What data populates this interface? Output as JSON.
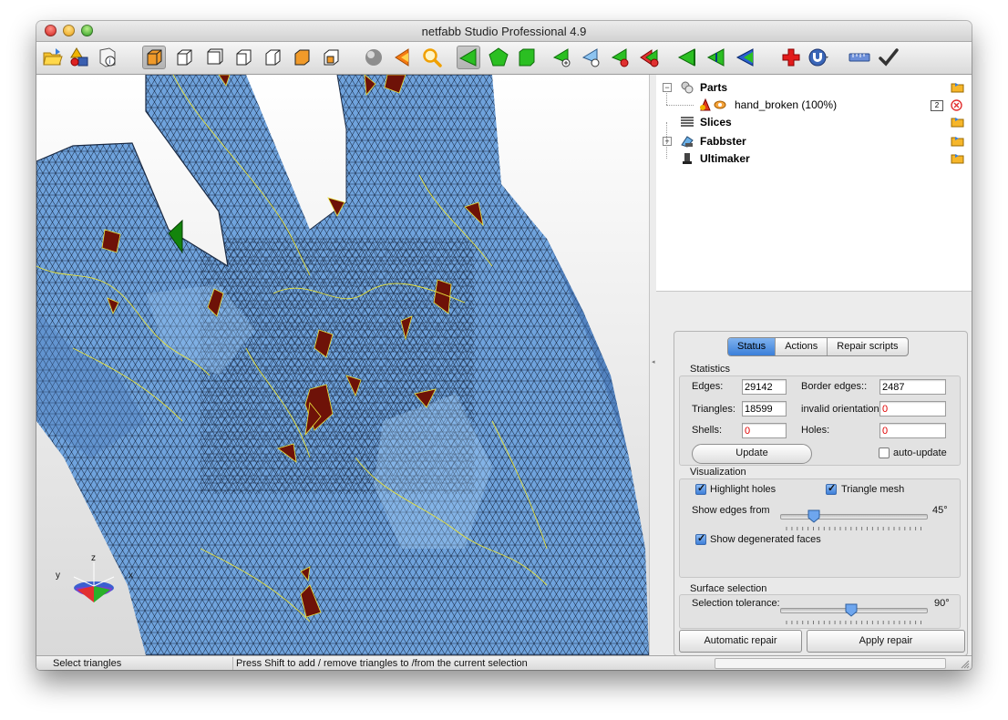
{
  "window": {
    "title": "netfabb Studio Professional 4.9"
  },
  "toolbar": {
    "buttons": [
      "open-folder-icon",
      "add-part-icon",
      "part-info-icon",
      "view-default-icon",
      "view-front-icon",
      "view-back-icon",
      "view-left-icon",
      "view-right-icon",
      "view-top-icon",
      "view-bottom-icon",
      "sphere-icon",
      "triangle-orange-icon",
      "zoom-icon",
      "select-triangle-icon",
      "select-surface-icon",
      "select-shell-icon",
      "add-triangle-icon",
      "delete-triangle-icon",
      "remove-triangle-icon",
      "remove-all-icon",
      "triangle-green-left-icon",
      "triangle-green-flip-icon",
      "triangle-blue-icon",
      "red-cross-icon",
      "magnet-icon",
      "ruler-icon",
      "checkmark-icon"
    ]
  },
  "tree": {
    "parts_label": "Parts",
    "part_item_label": "hand_broken (100%)",
    "part_item_badge": "2",
    "slices_label": "Slices",
    "fabbster_label": "Fabbster",
    "ultimaker_label": "Ultimaker"
  },
  "tabs": {
    "status": "Status",
    "actions": "Actions",
    "repair_scripts": "Repair scripts"
  },
  "statistics": {
    "title": "Statistics",
    "edges_label": "Edges:",
    "edges_value": "29142",
    "border_edges_label": "Border edges::",
    "border_edges_value": "2487",
    "triangles_label": "Triangles:",
    "triangles_value": "18599",
    "invalid_orientation_label": "invalid orientation:",
    "invalid_orientation_value": "0",
    "shells_label": "Shells:",
    "shells_value": "0",
    "holes_label": "Holes:",
    "holes_value": "0",
    "update_button": "Update",
    "auto_update_label": "auto-update",
    "auto_update_checked": false
  },
  "visualization": {
    "title": "Visualization",
    "highlight_holes_label": "Highlight holes",
    "highlight_holes_checked": true,
    "triangle_mesh_label": "Triangle mesh",
    "triangle_mesh_checked": true,
    "show_edges_label": "Show edges from",
    "show_edges_value": "45°",
    "show_edges_level": 0.23,
    "show_degenerated_label": "Show degenerated faces",
    "show_degenerated_checked": true
  },
  "surface_selection": {
    "title": "Surface selection",
    "tolerance_label": "Selection tolerance:",
    "tolerance_value": "90°",
    "tolerance_level": 0.49
  },
  "buttons": {
    "automatic_repair": "Automatic repair",
    "apply_repair": "Apply repair"
  },
  "axis": {
    "x": "x",
    "y": "y",
    "z": "z"
  },
  "colors": {
    "mesh_fill": "#6fa3dd",
    "mesh_lines": "#1a2a44",
    "hole_fill": "#6e1208",
    "border_edges": "#e8e23a",
    "selected_tab": "#4a8be0"
  },
  "statusbar": {
    "mode": "Select triangles",
    "hint": "Press Shift to add / remove triangles to /from the current selection"
  }
}
